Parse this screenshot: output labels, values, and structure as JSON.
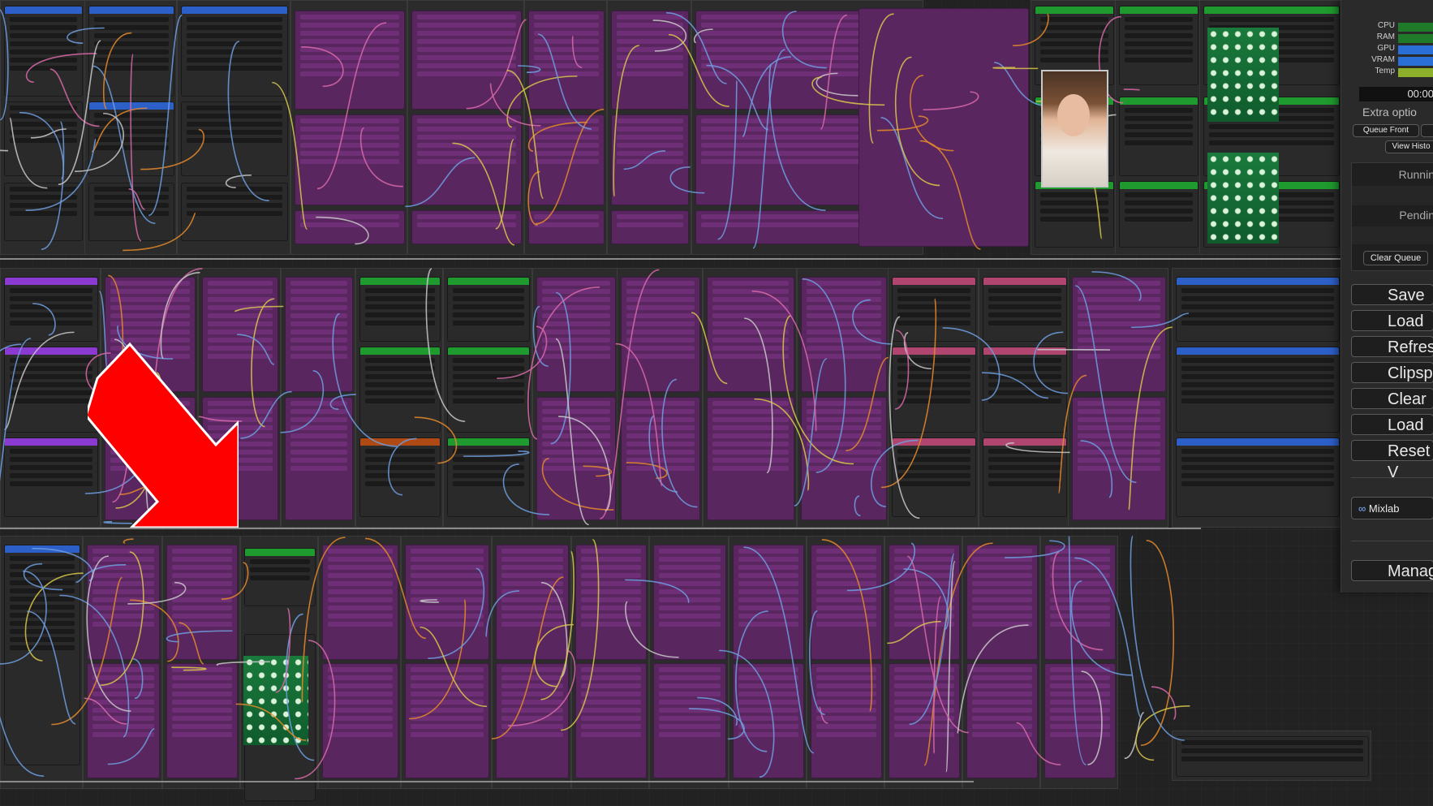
{
  "system_monitor": {
    "labels": [
      "CPU",
      "RAM",
      "GPU",
      "VRAM",
      "Temp"
    ],
    "colors": [
      "#1f7a2a",
      "#1f7a2a",
      "#2a6fd6",
      "#2a6fd6",
      "#8db02a"
    ]
  },
  "queue": {
    "timer": "00:00",
    "extra_options": "Extra optio",
    "queue_front": "Queue Front",
    "view_history": "View Histo",
    "running": "Runnin",
    "pending": "Pendin",
    "clear_queue": "Clear Queue"
  },
  "menu_buttons": [
    "Save",
    "Load",
    "Refres",
    "Clipspa",
    "Clear",
    "Load De",
    "Reset V"
  ],
  "mixlab_label": "Mixlab",
  "manager_label": "Manag",
  "annotation": {
    "arrow_color": "#ff0000",
    "arrow_outline": "#ffffff"
  },
  "colors": {
    "node_purple": "#5a2660",
    "node_gray": "#353535",
    "header_blue": "#2d5fc9",
    "header_green": "#1f9a2f",
    "header_pink": "#b0456f",
    "header_violet": "#8a3ad0",
    "wire_blue": "#6f9fe0",
    "wire_yellow": "#d8c84a",
    "wire_orange": "#e58a2a",
    "wire_pink": "#d86aa8"
  }
}
